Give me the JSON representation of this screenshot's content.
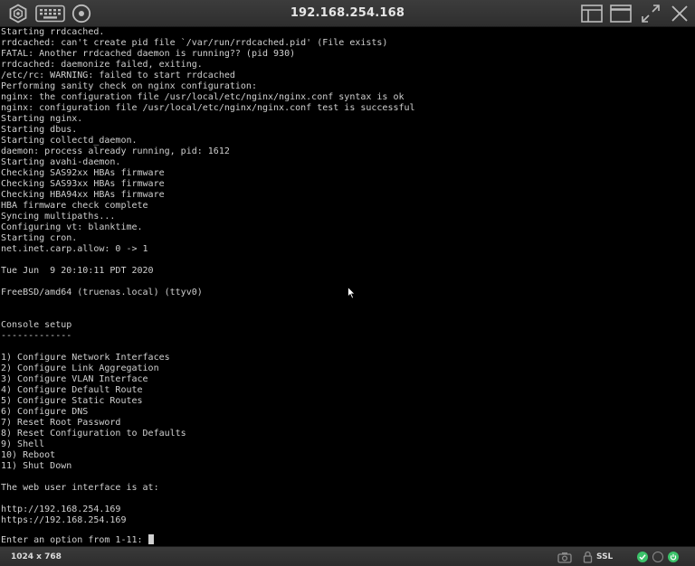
{
  "window": {
    "title": "192.168.254.168"
  },
  "toolbar": {
    "icons": [
      "settings-hex-icon",
      "keyboard-icon",
      "disc-icon"
    ],
    "right_icons": [
      "layout-panel-icon",
      "window-icon",
      "fullscreen-icon",
      "close-icon"
    ]
  },
  "console": {
    "lines": [
      "Starting rrdcached.",
      "rrdcached: can't create pid file `/var/run/rrdcached.pid' (File exists)",
      "FATAL: Another rrdcached daemon is running?? (pid 930)",
      "rrdcached: daemonize failed, exiting.",
      "/etc/rc: WARNING: failed to start rrdcached",
      "Performing sanity check on nginx configuration:",
      "nginx: the configuration file /usr/local/etc/nginx/nginx.conf syntax is ok",
      "nginx: configuration file /usr/local/etc/nginx/nginx.conf test is successful",
      "Starting nginx.",
      "Starting dbus.",
      "Starting collectd_daemon.",
      "daemon: process already running, pid: 1612",
      "Starting avahi-daemon.",
      "Checking SAS92xx HBAs firmware",
      "Checking SAS93xx HBAs firmware",
      "Checking HBA94xx HBAs firmware",
      "HBA firmware check complete",
      "Syncing multipaths...",
      "Configuring vt: blanktime.",
      "Starting cron.",
      "net.inet.carp.allow: 0 -> 1",
      "",
      "Tue Jun  9 20:10:11 PDT 2020",
      "",
      "FreeBSD/amd64 (truenas.local) (ttyv0)",
      "",
      "",
      "Console setup",
      "-------------",
      "",
      "1) Configure Network Interfaces",
      "2) Configure Link Aggregation",
      "3) Configure VLAN Interface",
      "4) Configure Default Route",
      "5) Configure Static Routes",
      "6) Configure DNS",
      "7) Reset Root Password",
      "8) Reset Configuration to Defaults",
      "9) Shell",
      "10) Reboot",
      "11) Shut Down",
      "",
      "The web user interface is at:",
      "",
      "http://192.168.254.169",
      "https://192.168.254.169"
    ],
    "prompt": "Enter an option from 1-11: "
  },
  "statusbar": {
    "resolution": "1024 x 768",
    "ssl_label": "SSL",
    "colors": {
      "ok_green": "#3cc36a",
      "power_green": "#3cc36a",
      "gray": "#8a8a8a"
    }
  }
}
